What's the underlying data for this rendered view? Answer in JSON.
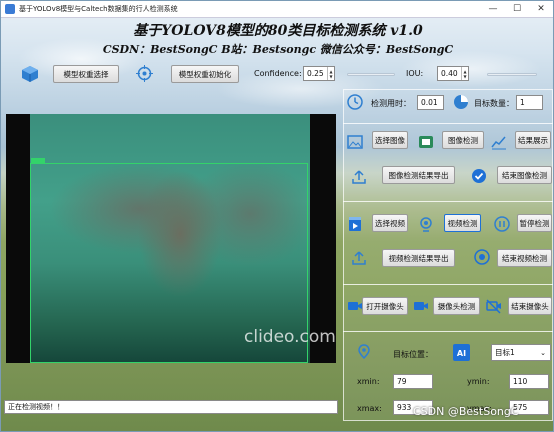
{
  "window": {
    "title": "基于YOLOv8模型与Caltech数据集的行人检测系统",
    "minimize": "—",
    "maximize": "☐",
    "close": "✕"
  },
  "header": {
    "title": "基于YOLOV8模型的80类目标检测系统 v1.0",
    "subtitle": "CSDN：BestSongC   B站：Bestsongc   微信公众号：BestSongC"
  },
  "model": {
    "select_label": "模型权重选择",
    "init_label": "模型权重初始化"
  },
  "confidence": {
    "label": "Confidence:",
    "value": "0.25"
  },
  "iou": {
    "label": "IOU:",
    "value": "0.40"
  },
  "stats": {
    "time_label": "检测用时：",
    "time_value": "0.01",
    "count_label": "目标数量：",
    "count_value": "1"
  },
  "image_section": {
    "select": "选择图像",
    "detect": "图像检测",
    "show": "结果展示",
    "export": "图像检测结果导出",
    "end": "结束图像检测"
  },
  "video_section": {
    "select": "选择视频",
    "detect": "视频检测",
    "pause": "暂停检测",
    "export": "视频检测结果导出",
    "end": "结束视频检测"
  },
  "camera_section": {
    "open": "打开摄像头",
    "detect": "摄像头检测",
    "end": "结束摄像头"
  },
  "target": {
    "label": "目标位置：",
    "selected": "目标1"
  },
  "coords": {
    "xmin_label": "xmin:",
    "xmin": "79",
    "ymin_label": "ymin:",
    "ymin": "110",
    "xmax_label": "xmax:",
    "xmax": "933",
    "ymax_label": "ymax:",
    "ymax": "575"
  },
  "status": {
    "text": "正在检测视频！！"
  },
  "overlay": {
    "watermark": "clideo.com",
    "csdn": "CSDN @BestSongC"
  },
  "colors": {
    "accent": "#1e70d6",
    "bbox": "#33d36a"
  }
}
